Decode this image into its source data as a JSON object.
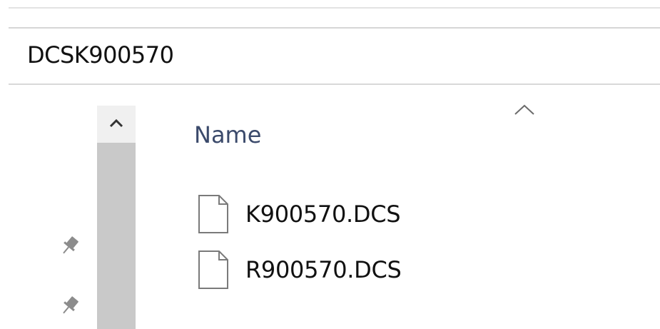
{
  "address_bar": {
    "path": "DCSK900570"
  },
  "file_list": {
    "column_header": "Name",
    "sort_indicator_icon": "chevron-up-icon",
    "files": [
      {
        "name": "K900570.DCS",
        "icon": "file-icon"
      },
      {
        "name": "R900570.DCS",
        "icon": "file-icon"
      }
    ]
  },
  "navigation_pane": {
    "pins": [
      "pin-icon",
      "pin-icon"
    ]
  },
  "scrollbar": {
    "up_arrow_icon": "chevron-up-icon"
  },
  "colors": {
    "header_text": "#3b4a6b",
    "scrollbar_track": "#f0f0f0",
    "scrollbar_thumb": "#c9c9c9"
  }
}
